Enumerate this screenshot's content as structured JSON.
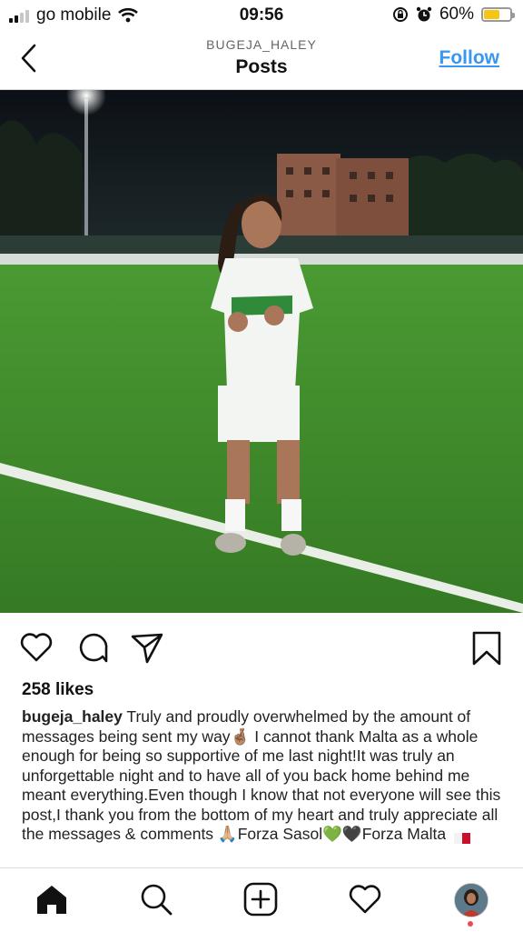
{
  "status_bar": {
    "carrier": "go mobile",
    "time": "09:56",
    "battery": "60%",
    "battery_level": 0.6
  },
  "header": {
    "username": "BUGEJA_HALEY",
    "title": "Posts",
    "follow_label": "Follow"
  },
  "post": {
    "likes": "258 likes",
    "caption_user": "bugeja_haley",
    "caption_parts": [
      " Truly and proudly overwhelmed by the amount of messages being sent my way",
      "🤞🏽",
      " I cannot thank Malta as a whole enough for being so supportive of me last night!It was truly an unforgettable night and to have all of you back home behind me meant everything.Even though I know that not everyone will see this post,I thank you from the bottom of my heart and truly appreciate all the messages & comments ",
      "🙏🏼",
      "Forza Sasol",
      "💚",
      "🖤",
      "Forza Malta "
    ]
  },
  "colors": {
    "link": "#3897f0",
    "battery_fill": "#f5c518",
    "grass": "#3f8a2c",
    "notification": "#ed4956"
  },
  "icons": {
    "actions": [
      "heart-icon",
      "comment-icon",
      "share-icon",
      "bookmark-icon"
    ],
    "nav": [
      "home-icon",
      "search-icon",
      "add-icon",
      "activity-heart-icon",
      "profile-avatar"
    ]
  }
}
